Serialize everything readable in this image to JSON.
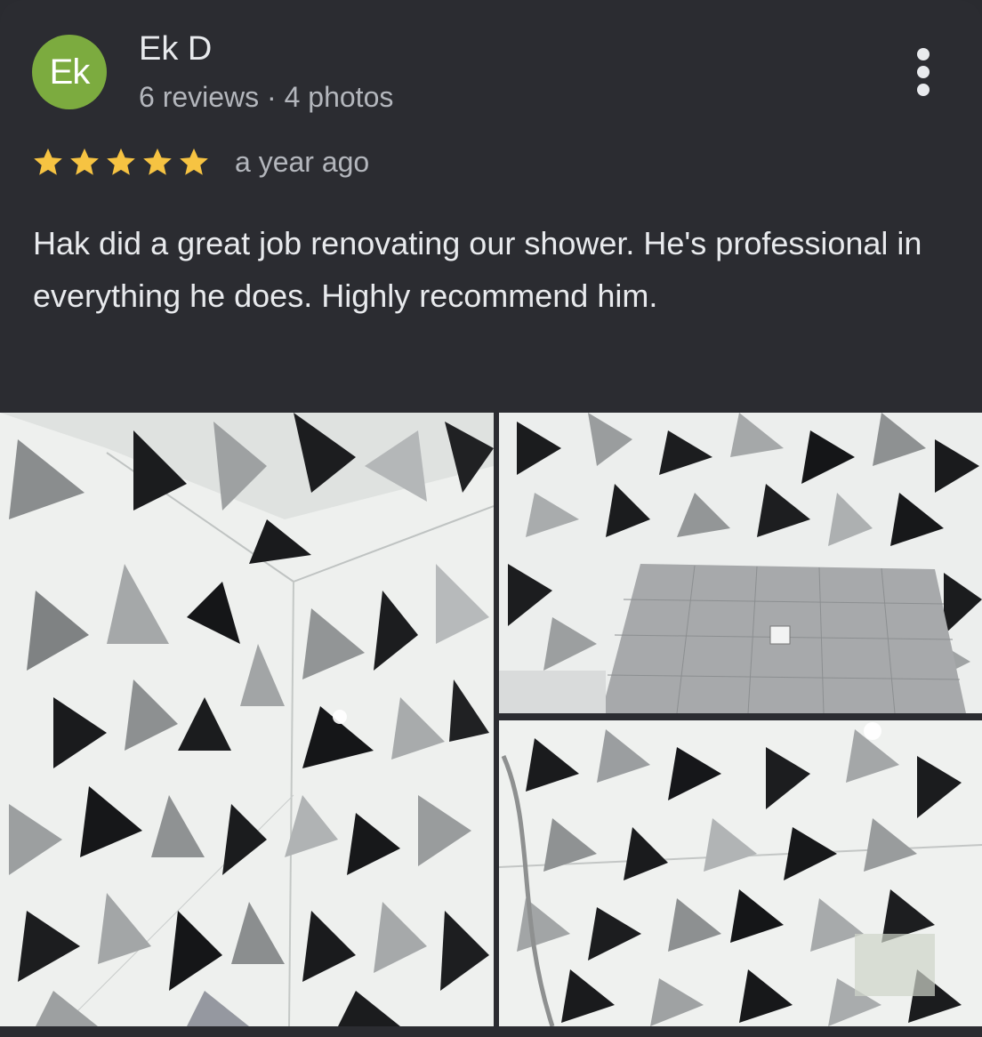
{
  "reviewer": {
    "initials": "Ek",
    "name": "Ek D",
    "meta": "6 reviews · 4 photos",
    "avatar_color": "#7cab3f"
  },
  "menu": {
    "icon": "more-vertical-icon"
  },
  "rating": {
    "stars": 5,
    "max": 5,
    "icon": "star-icon",
    "color": "#f6c342"
  },
  "time": "a year ago",
  "review_text": "Hak did a great job renovating our shower. He's professional in everything he does. Highly recommend him.",
  "photos": [
    {
      "name": "photo-1",
      "description": "geometric tiled shower wall corner"
    },
    {
      "name": "photo-2",
      "description": "shower floor with drain"
    },
    {
      "name": "photo-3",
      "description": "tiled shower wall with hose"
    }
  ]
}
